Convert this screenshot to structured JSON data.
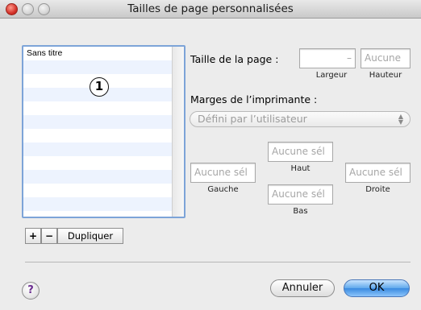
{
  "window": {
    "title": "Tailles de page personnalisées"
  },
  "list": {
    "items": [
      "Sans titre",
      "",
      "",
      "",
      "",
      "",
      "",
      "",
      "",
      "",
      "",
      ""
    ],
    "callout": "1"
  },
  "list_buttons": {
    "add": "+",
    "remove": "−",
    "duplicate": "Dupliquer"
  },
  "page_size": {
    "label": "Taille de la page :",
    "width_value": "–",
    "width_label": "Largeur",
    "height_placeholder": "Aucune",
    "height_label": "Hauteur"
  },
  "margins": {
    "label": "Marges de l’imprimante :",
    "selected": "Défini par l’utilisateur",
    "top_placeholder": "Aucune sél",
    "top_label": "Haut",
    "left_placeholder": "Aucune sél",
    "left_label": "Gauche",
    "right_placeholder": "Aucune sél",
    "right_label": "Droite",
    "bottom_placeholder": "Aucune sél",
    "bottom_label": "Bas"
  },
  "footer": {
    "help": "?",
    "cancel": "Annuler",
    "ok": "OK"
  },
  "colors": {
    "accent": "#5fa8ec",
    "list_border": "#7da4d8",
    "stripe": "#edf3fe"
  }
}
